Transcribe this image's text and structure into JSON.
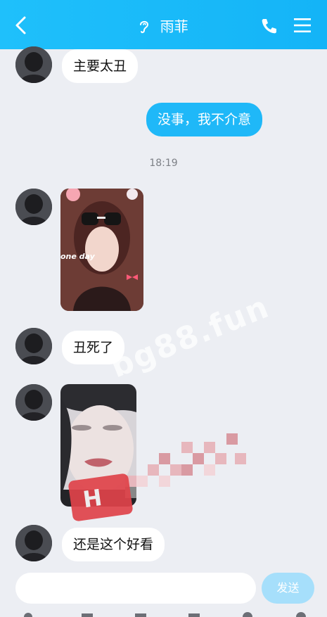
{
  "header": {
    "title": "雨菲",
    "icons": [
      "back-icon",
      "ear-icon",
      "phone-icon",
      "menu-icon"
    ]
  },
  "messages": [
    {
      "side": "received",
      "text": "主要太丑"
    },
    {
      "side": "sent",
      "text": "没事，我不介意"
    },
    {
      "type": "timestamp",
      "text": "18:19"
    },
    {
      "side": "received",
      "type": "image",
      "caption": "one day"
    },
    {
      "side": "received",
      "text": "丑死了"
    },
    {
      "side": "received",
      "type": "image"
    },
    {
      "side": "received",
      "text": "还是这个好看"
    }
  ],
  "overlay": {
    "watermark": "bg88.fun",
    "badge": "H"
  },
  "composer": {
    "placeholder": "",
    "send_label": "发送"
  },
  "colors": {
    "header": "#1fc0fb",
    "sent_bubble": "#1fb8f8",
    "background": "#eceef3",
    "send_button": "#a6dffb"
  }
}
